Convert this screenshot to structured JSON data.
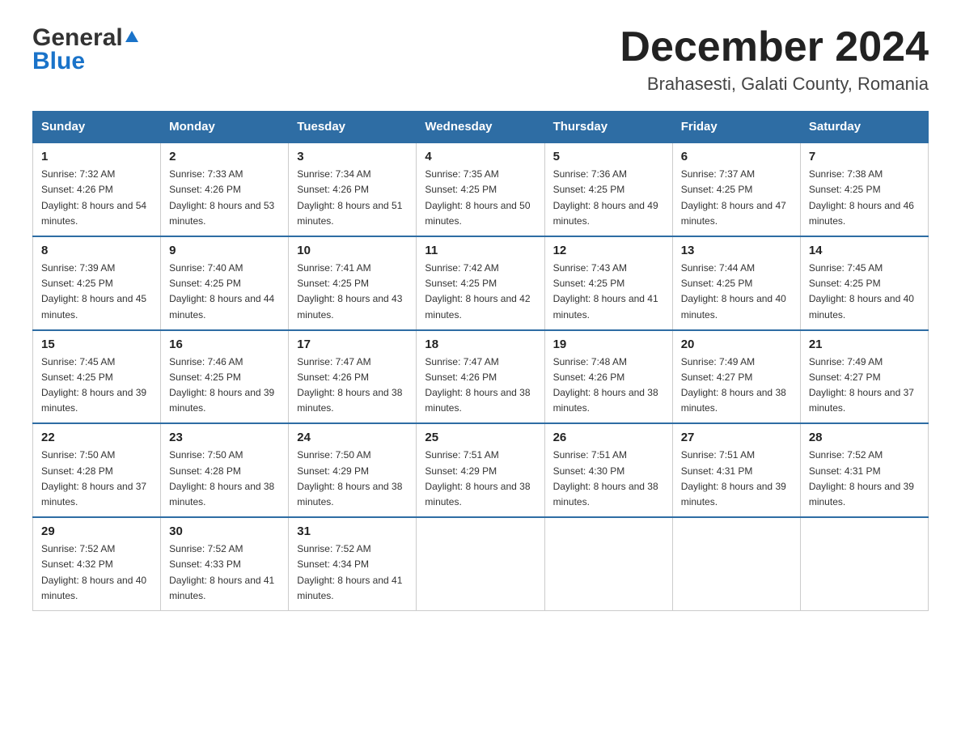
{
  "header": {
    "logo_general": "General",
    "logo_blue": "Blue",
    "month_title": "December 2024",
    "location": "Brahasesti, Galati County, Romania"
  },
  "columns": [
    "Sunday",
    "Monday",
    "Tuesday",
    "Wednesday",
    "Thursday",
    "Friday",
    "Saturday"
  ],
  "weeks": [
    [
      {
        "day": "1",
        "sunrise": "7:32 AM",
        "sunset": "4:26 PM",
        "daylight": "8 hours and 54 minutes."
      },
      {
        "day": "2",
        "sunrise": "7:33 AM",
        "sunset": "4:26 PM",
        "daylight": "8 hours and 53 minutes."
      },
      {
        "day": "3",
        "sunrise": "7:34 AM",
        "sunset": "4:26 PM",
        "daylight": "8 hours and 51 minutes."
      },
      {
        "day": "4",
        "sunrise": "7:35 AM",
        "sunset": "4:25 PM",
        "daylight": "8 hours and 50 minutes."
      },
      {
        "day": "5",
        "sunrise": "7:36 AM",
        "sunset": "4:25 PM",
        "daylight": "8 hours and 49 minutes."
      },
      {
        "day": "6",
        "sunrise": "7:37 AM",
        "sunset": "4:25 PM",
        "daylight": "8 hours and 47 minutes."
      },
      {
        "day": "7",
        "sunrise": "7:38 AM",
        "sunset": "4:25 PM",
        "daylight": "8 hours and 46 minutes."
      }
    ],
    [
      {
        "day": "8",
        "sunrise": "7:39 AM",
        "sunset": "4:25 PM",
        "daylight": "8 hours and 45 minutes."
      },
      {
        "day": "9",
        "sunrise": "7:40 AM",
        "sunset": "4:25 PM",
        "daylight": "8 hours and 44 minutes."
      },
      {
        "day": "10",
        "sunrise": "7:41 AM",
        "sunset": "4:25 PM",
        "daylight": "8 hours and 43 minutes."
      },
      {
        "day": "11",
        "sunrise": "7:42 AM",
        "sunset": "4:25 PM",
        "daylight": "8 hours and 42 minutes."
      },
      {
        "day": "12",
        "sunrise": "7:43 AM",
        "sunset": "4:25 PM",
        "daylight": "8 hours and 41 minutes."
      },
      {
        "day": "13",
        "sunrise": "7:44 AM",
        "sunset": "4:25 PM",
        "daylight": "8 hours and 40 minutes."
      },
      {
        "day": "14",
        "sunrise": "7:45 AM",
        "sunset": "4:25 PM",
        "daylight": "8 hours and 40 minutes."
      }
    ],
    [
      {
        "day": "15",
        "sunrise": "7:45 AM",
        "sunset": "4:25 PM",
        "daylight": "8 hours and 39 minutes."
      },
      {
        "day": "16",
        "sunrise": "7:46 AM",
        "sunset": "4:25 PM",
        "daylight": "8 hours and 39 minutes."
      },
      {
        "day": "17",
        "sunrise": "7:47 AM",
        "sunset": "4:26 PM",
        "daylight": "8 hours and 38 minutes."
      },
      {
        "day": "18",
        "sunrise": "7:47 AM",
        "sunset": "4:26 PM",
        "daylight": "8 hours and 38 minutes."
      },
      {
        "day": "19",
        "sunrise": "7:48 AM",
        "sunset": "4:26 PM",
        "daylight": "8 hours and 38 minutes."
      },
      {
        "day": "20",
        "sunrise": "7:49 AM",
        "sunset": "4:27 PM",
        "daylight": "8 hours and 38 minutes."
      },
      {
        "day": "21",
        "sunrise": "7:49 AM",
        "sunset": "4:27 PM",
        "daylight": "8 hours and 37 minutes."
      }
    ],
    [
      {
        "day": "22",
        "sunrise": "7:50 AM",
        "sunset": "4:28 PM",
        "daylight": "8 hours and 37 minutes."
      },
      {
        "day": "23",
        "sunrise": "7:50 AM",
        "sunset": "4:28 PM",
        "daylight": "8 hours and 38 minutes."
      },
      {
        "day": "24",
        "sunrise": "7:50 AM",
        "sunset": "4:29 PM",
        "daylight": "8 hours and 38 minutes."
      },
      {
        "day": "25",
        "sunrise": "7:51 AM",
        "sunset": "4:29 PM",
        "daylight": "8 hours and 38 minutes."
      },
      {
        "day": "26",
        "sunrise": "7:51 AM",
        "sunset": "4:30 PM",
        "daylight": "8 hours and 38 minutes."
      },
      {
        "day": "27",
        "sunrise": "7:51 AM",
        "sunset": "4:31 PM",
        "daylight": "8 hours and 39 minutes."
      },
      {
        "day": "28",
        "sunrise": "7:52 AM",
        "sunset": "4:31 PM",
        "daylight": "8 hours and 39 minutes."
      }
    ],
    [
      {
        "day": "29",
        "sunrise": "7:52 AM",
        "sunset": "4:32 PM",
        "daylight": "8 hours and 40 minutes."
      },
      {
        "day": "30",
        "sunrise": "7:52 AM",
        "sunset": "4:33 PM",
        "daylight": "8 hours and 41 minutes."
      },
      {
        "day": "31",
        "sunrise": "7:52 AM",
        "sunset": "4:34 PM",
        "daylight": "8 hours and 41 minutes."
      },
      null,
      null,
      null,
      null
    ]
  ]
}
